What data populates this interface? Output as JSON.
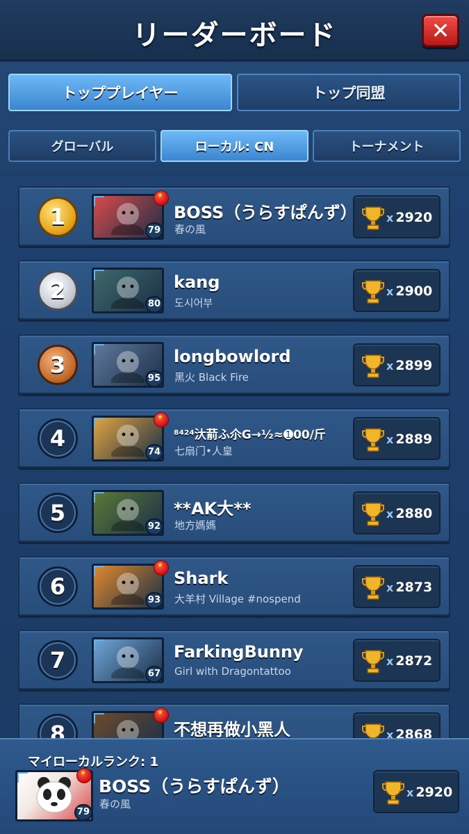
{
  "header": {
    "title": "リーダーボード",
    "close_label": "✕"
  },
  "tabs": [
    {
      "label": "トッププレイヤー",
      "active": true
    },
    {
      "label": "トップ同盟",
      "active": false
    }
  ],
  "subtabs": [
    {
      "label": "グローバル",
      "active": false
    },
    {
      "label": "ローカル: CN",
      "active": true
    },
    {
      "label": "トーナメント",
      "active": false
    }
  ],
  "players": [
    {
      "rank": "1",
      "name": "BOSS（うらすぱんず）",
      "guild": "春の風",
      "level": "79",
      "score": "2920",
      "flag": true,
      "avatar": "panda-portrait",
      "color": "#d94a4a"
    },
    {
      "rank": "2",
      "name": "kang",
      "guild": "도시어부",
      "level": "80",
      "score": "2900",
      "flag": false,
      "avatar": "warrior-woman-portrait",
      "color": "#3e6a6a"
    },
    {
      "rank": "3",
      "name": "longbowlord",
      "guild": "黑火 Black Fire",
      "level": "95",
      "score": "2899",
      "flag": false,
      "avatar": "armored-beast-portrait",
      "color": "#5f7a9c"
    },
    {
      "rank": "4",
      "name": "⁸⁴²⁴汏葥ふ尒G→½≈➊00/斤",
      "guild": "七扇门•人皇",
      "level": "74",
      "score": "2889",
      "flag": true,
      "avatar": "tiger-portrait",
      "color": "#e3a53f"
    },
    {
      "rank": "5",
      "name": "**AK大**",
      "guild": "地方媽媽",
      "level": "92",
      "score": "2880",
      "flag": false,
      "avatar": "orc-portrait",
      "color": "#5b7a36"
    },
    {
      "rank": "6",
      "name": "Shark",
      "guild": "大羊村 Village #nospend",
      "level": "93",
      "score": "2873",
      "flag": true,
      "avatar": "fox-portrait",
      "color": "#e08a2c"
    },
    {
      "rank": "7",
      "name": "FarkingBunny",
      "guild": "Girl with Dragontattoo",
      "level": "67",
      "score": "2872",
      "flag": false,
      "avatar": "cat-portrait",
      "color": "#6fa6d8"
    },
    {
      "rank": "8",
      "name": "不想再做小黑人",
      "guild": "",
      "level": "",
      "score": "2868",
      "flag": true,
      "avatar": "shaman-portrait",
      "color": "#6b4a2c"
    }
  ],
  "footer": {
    "label": "マイローカルランク: 1",
    "name": "BOSS（うらすぱんず）",
    "guild": "春の風",
    "level": "79",
    "score": "2920",
    "x_label": "x"
  },
  "icons": {
    "trophy": "trophy-icon",
    "flag": "china-flag-icon",
    "close": "close-icon"
  }
}
